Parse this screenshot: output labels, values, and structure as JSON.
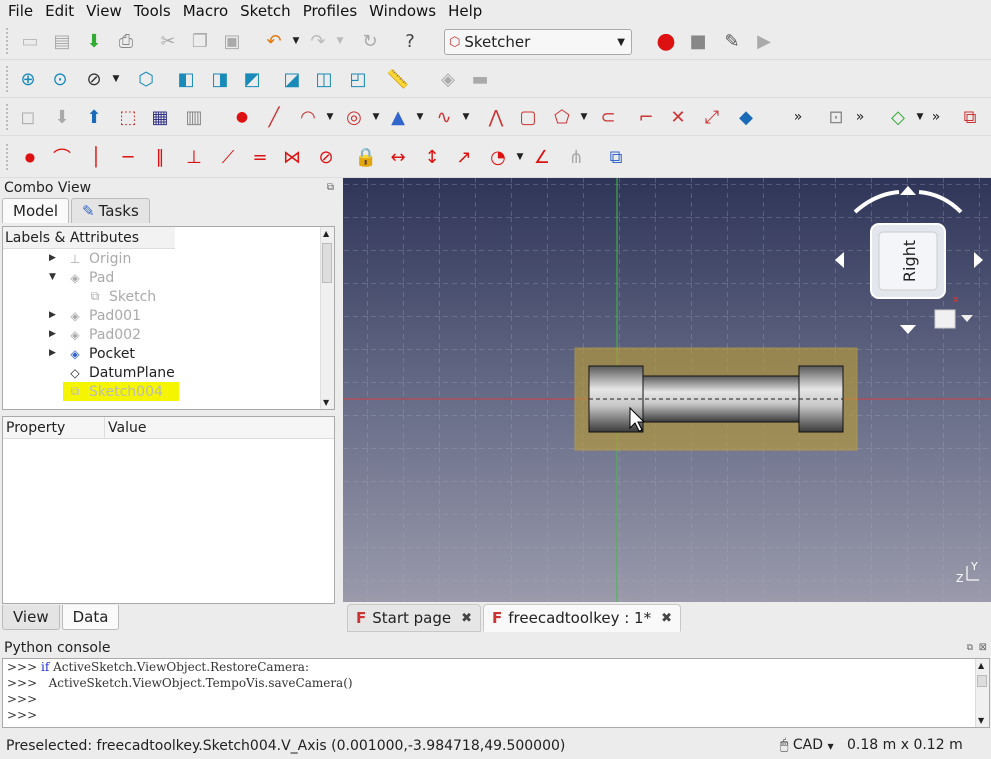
{
  "menubar": {
    "items": [
      "File",
      "Edit",
      "View",
      "Tools",
      "Macro",
      "Sketch",
      "Profiles",
      "Windows",
      "Help"
    ]
  },
  "toolbar": {
    "workbench": "Sketcher"
  },
  "combo": {
    "title": "Combo View",
    "tabs": [
      {
        "label": "Model"
      },
      {
        "label": "Tasks"
      }
    ],
    "tree_header": "Labels & Attributes",
    "tree": [
      {
        "label": "Origin",
        "icon": "origin-icon",
        "dim": true
      },
      {
        "label": "Pad",
        "icon": "pad-icon",
        "dim": true
      },
      {
        "label": "Sketch",
        "icon": "sketch-icon",
        "dim": true
      },
      {
        "label": "Pad001",
        "icon": "pad-icon",
        "dim": true
      },
      {
        "label": "Pad002",
        "icon": "pad-icon",
        "dim": true
      },
      {
        "label": "Pocket",
        "icon": "pocket-icon",
        "dim": false
      },
      {
        "label": "DatumPlane",
        "icon": "datum-plane-icon",
        "dim": false
      },
      {
        "label": "Sketch004",
        "icon": "sketch-icon",
        "dim": true,
        "selected": true
      }
    ],
    "prop_headers": [
      "Property",
      "Value"
    ],
    "bottom_tabs": [
      {
        "label": "View"
      },
      {
        "label": "Data"
      }
    ]
  },
  "viewport": {
    "navcube_face": "Right",
    "axis_y": "Y",
    "axis_z": "Z"
  },
  "doc_tabs": [
    {
      "label": "Start page"
    },
    {
      "label": "freecadtoolkey : 1*"
    }
  ],
  "python_console": {
    "title": "Python console",
    "lines": [
      {
        "prompt": ">>>",
        "keyword": "if",
        "text": " ActiveSketch.ViewObject.RestoreCamera:"
      },
      {
        "prompt": ">>>",
        "keyword": "",
        "text": "   ActiveSketch.ViewObject.TempoVis.saveCamera()"
      },
      {
        "prompt": ">>>",
        "keyword": "",
        "text": ""
      },
      {
        "prompt": ">>>",
        "keyword": "",
        "text": ""
      }
    ]
  },
  "statusbar": {
    "preselected": "Preselected: freecadtoolkey.Sketch004.V_Axis (0.001000,-3.984718,49.500000)",
    "nav_style": "CAD",
    "dimensions": "0.18 m x 0.12 m"
  },
  "colors": {
    "selection_highlight": "#f5f500",
    "x_axis_red": "#d04040",
    "y_axis_green": "#40c040"
  }
}
